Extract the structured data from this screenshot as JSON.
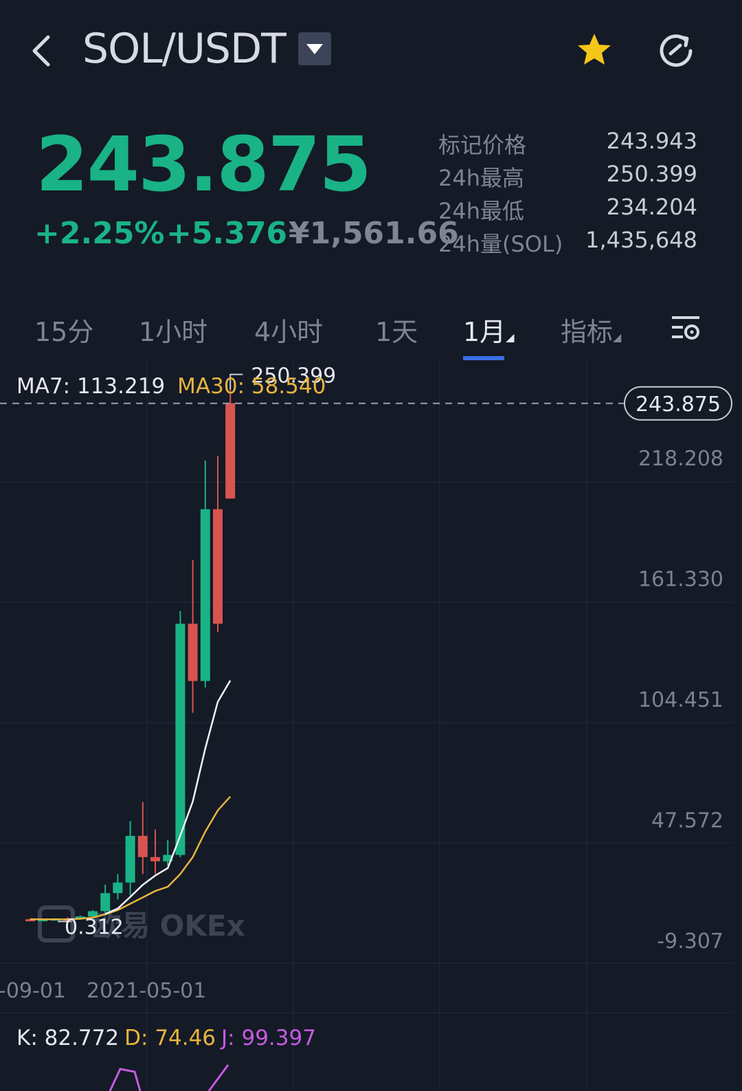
{
  "header": {
    "pair": "SOL/USDT",
    "colors": {
      "up": "#19b386",
      "down": "#d9534f",
      "accent": "#3b6fe6",
      "star": "#f5c518"
    }
  },
  "ticker": {
    "last_price": "243.875",
    "change_pct": "+2.25%",
    "change_abs": "+5.376",
    "cny_price": "¥1,561.66",
    "stats": [
      {
        "label": "标记价格",
        "value": "243.943"
      },
      {
        "label": "24h最高",
        "value": "250.399"
      },
      {
        "label": "24h最低",
        "value": "234.204"
      },
      {
        "label": "24h量(SOL)",
        "value": "1,435,648"
      }
    ]
  },
  "tabs": [
    "15分",
    "1小时",
    "4小时",
    "1天",
    "1月",
    "指标"
  ],
  "active_tab": "1月",
  "ma_legend": {
    "ma7": "MA7: 113.219",
    "ma30": "MA30: 58.540"
  },
  "kdj_legend": {
    "k": "K: 82.772",
    "d": "D: 74.46",
    "j": "J: 99.397"
  },
  "watermark": "欧易 OKEx",
  "chart_data": {
    "type": "candlestick",
    "y_ticks": [
      "218.208",
      "161.330",
      "104.451",
      "47.572",
      "-9.307"
    ],
    "y_tick_values": [
      218.208,
      161.33,
      104.451,
      47.572,
      -9.307
    ],
    "x_ticks": [
      "-09-01",
      "2021-05-01"
    ],
    "current_price": 243.875,
    "current_price_label": "243.875",
    "high_label": "250.399",
    "high_value": 250.399,
    "low_label": "0.312",
    "low_value": 0.312,
    "candles": [
      {
        "o": 0.7,
        "h": 1.0,
        "l": 0.5,
        "c": 0.6
      },
      {
        "o": 0.6,
        "h": 0.8,
        "l": 0.312,
        "c": 0.7
      },
      {
        "o": 0.7,
        "h": 1.2,
        "l": 0.6,
        "c": 1.0
      },
      {
        "o": 1.0,
        "h": 1.6,
        "l": 0.8,
        "c": 0.9
      },
      {
        "o": 0.9,
        "h": 2.5,
        "l": 0.8,
        "c": 2.0
      },
      {
        "o": 2.0,
        "h": 5.0,
        "l": 1.8,
        "c": 4.5
      },
      {
        "o": 4.5,
        "h": 17.0,
        "l": 3.0,
        "c": 13.0
      },
      {
        "o": 13.0,
        "h": 22.0,
        "l": 10.0,
        "c": 18.0
      },
      {
        "o": 18.0,
        "h": 47.0,
        "l": 12.0,
        "c": 40.0
      },
      {
        "o": 40.0,
        "h": 56.0,
        "l": 22.0,
        "c": 30.0
      },
      {
        "o": 30.0,
        "h": 43.0,
        "l": 22.0,
        "c": 28.0
      },
      {
        "o": 28.0,
        "h": 38.0,
        "l": 26.0,
        "c": 31.0
      },
      {
        "o": 31.0,
        "h": 146.0,
        "l": 30.0,
        "c": 140.0
      },
      {
        "o": 140.0,
        "h": 170.0,
        "l": 98.0,
        "c": 113.0
      },
      {
        "o": 113.0,
        "h": 217.0,
        "l": 110.0,
        "c": 194.0
      },
      {
        "o": 194.0,
        "h": 219.0,
        "l": 136.0,
        "c": 140.0
      },
      {
        "o": 244.0,
        "h": 250.399,
        "l": 199.0,
        "c": 199.0
      }
    ],
    "ma7": [
      null,
      null,
      null,
      null,
      null,
      null,
      3.2,
      5.7,
      11.2,
      16.9,
      21.3,
      24.8,
      40.1,
      56.2,
      81.2,
      103.2,
      113.219
    ],
    "ma30": [
      0.7,
      0.65,
      0.65,
      0.7,
      0.9,
      1.5,
      3.0,
      5.0,
      8.0,
      11.0,
      14.0,
      16.0,
      22.0,
      30.0,
      42.0,
      52.0,
      58.54
    ]
  }
}
